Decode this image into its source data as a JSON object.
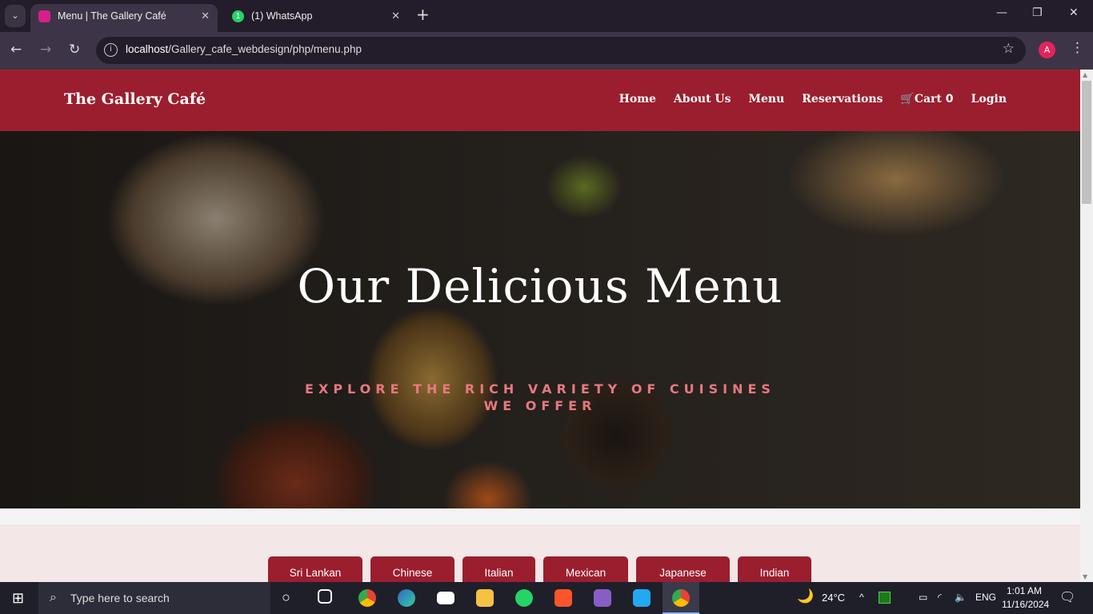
{
  "browser": {
    "tabs": [
      {
        "title": "Menu | The Gallery Café",
        "active": true
      },
      {
        "title": "(1) WhatsApp",
        "badge": "1"
      }
    ],
    "url_host": "localhost",
    "url_path": "/Gallery_cafe_webdesign/php/menu.php",
    "profile_initial": "A"
  },
  "site": {
    "brand": "The Gallery Café",
    "nav": [
      "Home",
      "About Us",
      "Menu",
      "Reservations"
    ],
    "cart_label": "Cart",
    "cart_count": "0",
    "login": "Login",
    "hero_title": "Our Delicious Menu",
    "hero_subtitle": "EXPLORE THE RICH VARIETY OF CUISINES WE OFFER",
    "categories": [
      "Sri Lankan",
      "Chinese",
      "Italian",
      "Mexican",
      "Japanese",
      "Indian"
    ],
    "colors": {
      "primary": "#9b1e2e",
      "accent": "#e8787f",
      "section_bg": "#f3e7e7"
    }
  },
  "taskbar": {
    "search_placeholder": "Type here to search",
    "temperature": "24°C",
    "language": "ENG",
    "time": "1:01 AM",
    "date": "11/16/2024"
  }
}
